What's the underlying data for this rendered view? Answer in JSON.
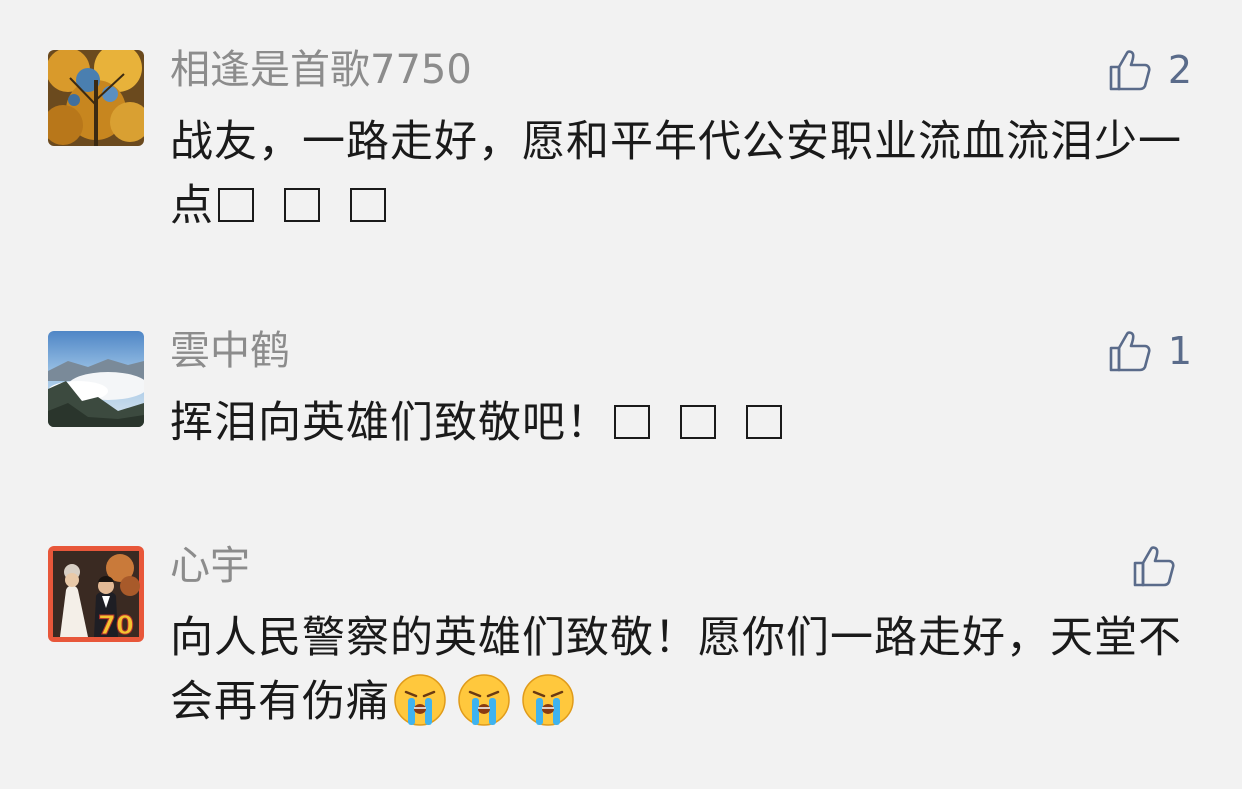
{
  "comments": [
    {
      "username": "相逢是首歌7750",
      "likes": "2",
      "text": "战友，一路走好，愿和平年代公安职业流血流泪少一点",
      "trailing_symbols": [
        "box",
        "box",
        "box"
      ],
      "avatar": "autumn-trees-avatar"
    },
    {
      "username": "雲中鹤",
      "likes": "1",
      "text": "挥泪向英雄们致敬吧！",
      "trailing_symbols": [
        "box",
        "box",
        "box"
      ],
      "avatar": "mountain-clouds-avatar"
    },
    {
      "username": "心宇",
      "likes": "",
      "text": "向人民警察的英雄们致敬！愿你们一路走好，天堂不会再有伤痛",
      "trailing_symbols": [
        "crying-emoji",
        "crying-emoji",
        "crying-emoji"
      ],
      "avatar": "wedding-photo-avatar",
      "avatar_badge": "70"
    }
  ],
  "colors": {
    "background": "#f2f2f2",
    "username": "#8c8c8c",
    "like": "#5a6b8a",
    "text": "#1a1a1a"
  },
  "icons": {
    "like": "thumbs-up-icon"
  }
}
